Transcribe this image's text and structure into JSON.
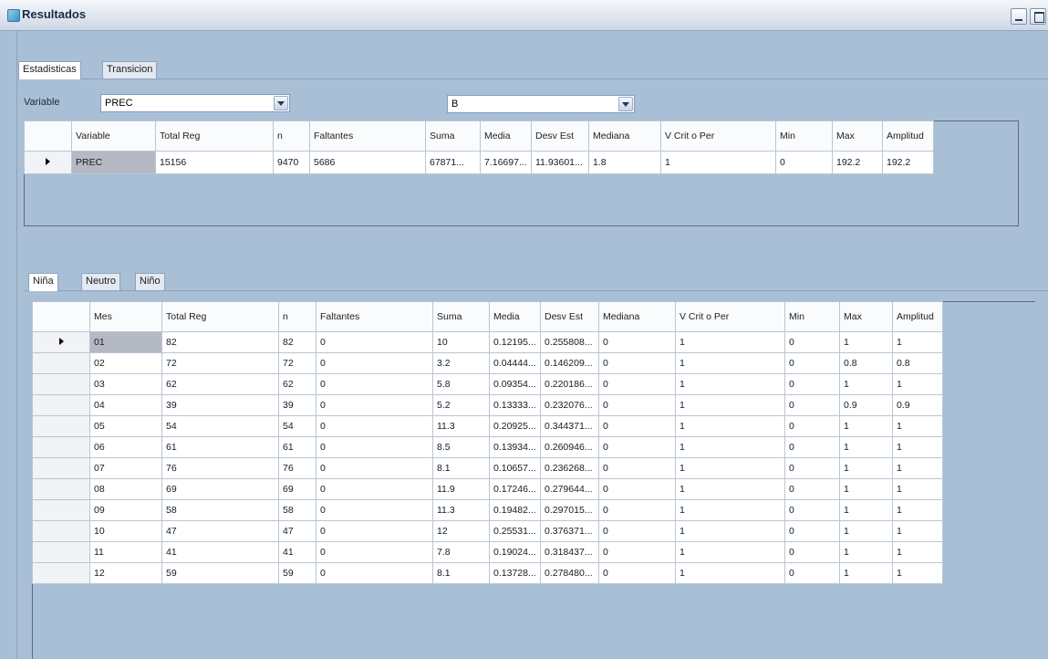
{
  "window": {
    "title": "Resultados"
  },
  "tabs_main": [
    {
      "label": "Estadisticas"
    },
    {
      "label": "Transicion"
    }
  ],
  "filter": {
    "variable_label": "Variable",
    "variable_value": "PREC",
    "second_value": "B"
  },
  "summary_table": {
    "headers": [
      "Variable",
      "Total Reg",
      "n",
      "Faltantes",
      "Suma",
      "Media",
      "Desv Est",
      "Mediana",
      "V Crit o Per",
      "Min",
      "Max",
      "Amplitud"
    ],
    "rows": [
      [
        "PREC",
        "15156",
        "9470",
        "5686",
        "67871...",
        "7.16697...",
        "11.93601...",
        "1.8",
        "1",
        "0",
        "192.2",
        "192.2"
      ]
    ]
  },
  "tabs_phase": [
    {
      "label": "Niña"
    },
    {
      "label": "Neutro"
    },
    {
      "label": "Niño"
    }
  ],
  "monthly_table": {
    "headers": [
      "Mes",
      "Total Reg",
      "n",
      "Faltantes",
      "Suma",
      "Media",
      "Desv Est",
      "Mediana",
      "V Crit o Per",
      "Min",
      "Max",
      "Amplitud"
    ],
    "rows": [
      [
        "01",
        "82",
        "82",
        "0",
        "10",
        "0.12195...",
        "0.255808...",
        "0",
        "1",
        "0",
        "1",
        "1"
      ],
      [
        "02",
        "72",
        "72",
        "0",
        "3.2",
        "0.04444...",
        "0.146209...",
        "0",
        "1",
        "0",
        "0.8",
        "0.8"
      ],
      [
        "03",
        "62",
        "62",
        "0",
        "5.8",
        "0.09354...",
        "0.220186...",
        "0",
        "1",
        "0",
        "1",
        "1"
      ],
      [
        "04",
        "39",
        "39",
        "0",
        "5.2",
        "0.13333...",
        "0.232076...",
        "0",
        "1",
        "0",
        "0.9",
        "0.9"
      ],
      [
        "05",
        "54",
        "54",
        "0",
        "11.3",
        "0.20925...",
        "0.344371...",
        "0",
        "1",
        "0",
        "1",
        "1"
      ],
      [
        "06",
        "61",
        "61",
        "0",
        "8.5",
        "0.13934...",
        "0.260946...",
        "0",
        "1",
        "0",
        "1",
        "1"
      ],
      [
        "07",
        "76",
        "76",
        "0",
        "8.1",
        "0.10657...",
        "0.236268...",
        "0",
        "1",
        "0",
        "1",
        "1"
      ],
      [
        "08",
        "69",
        "69",
        "0",
        "11.9",
        "0.17246...",
        "0.279644...",
        "0",
        "1",
        "0",
        "1",
        "1"
      ],
      [
        "09",
        "58",
        "58",
        "0",
        "11.3",
        "0.19482...",
        "0.297015...",
        "0",
        "1",
        "0",
        "1",
        "1"
      ],
      [
        "10",
        "47",
        "47",
        "0",
        "12",
        "0.25531...",
        "0.376371...",
        "0",
        "1",
        "0",
        "1",
        "1"
      ],
      [
        "11",
        "41",
        "41",
        "0",
        "7.8",
        "0.19024...",
        "0.318437...",
        "0",
        "1",
        "0",
        "1",
        "1"
      ],
      [
        "12",
        "59",
        "59",
        "0",
        "8.1",
        "0.13728...",
        "0.278480...",
        "0",
        "1",
        "0",
        "1",
        "1"
      ]
    ]
  }
}
